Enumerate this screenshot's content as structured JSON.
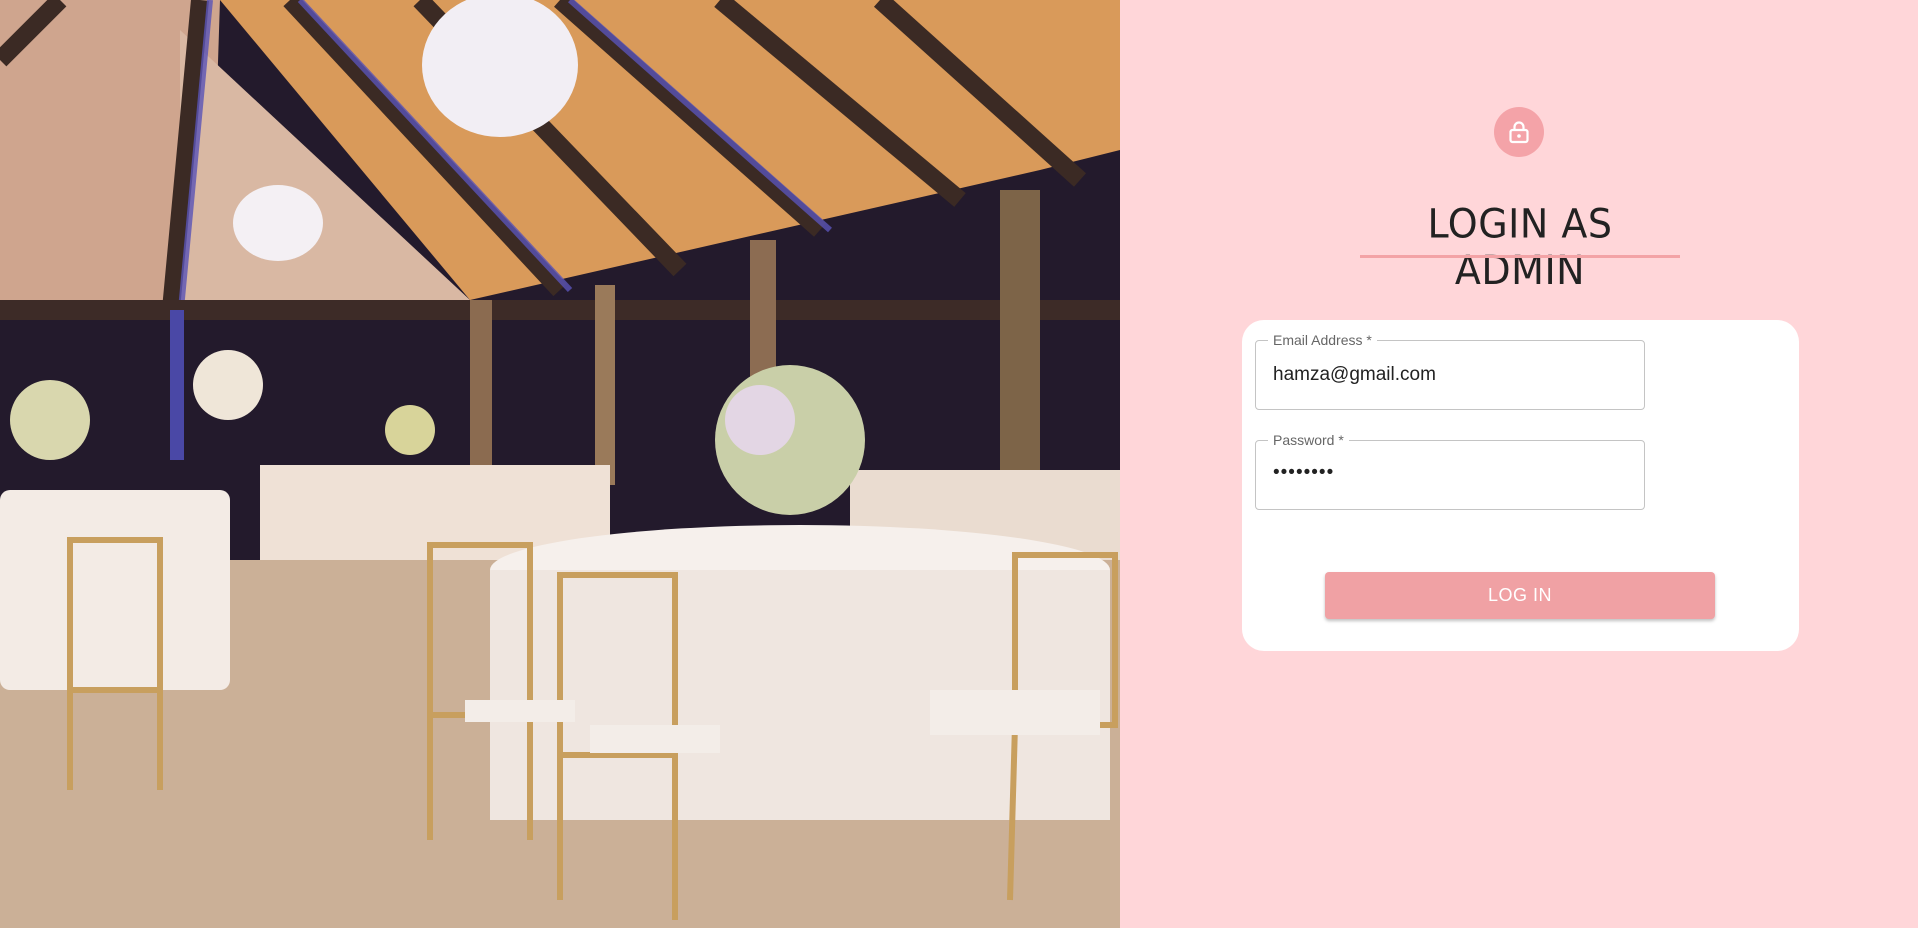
{
  "hero": {
    "description_icon": "wedding-hall-photo"
  },
  "login": {
    "icon": "lock-icon",
    "title": "LOGIN AS ADMIN",
    "email": {
      "label": "Email Address *",
      "value": "hamza@gmail.com"
    },
    "password": {
      "label": "Password *",
      "value": "••••••••"
    },
    "submit_label": "LOG IN"
  },
  "colors": {
    "page_background": "#ffd6d9",
    "accent": "#f4a3a8",
    "button": "#f0a1a4",
    "card": "#ffffff"
  }
}
